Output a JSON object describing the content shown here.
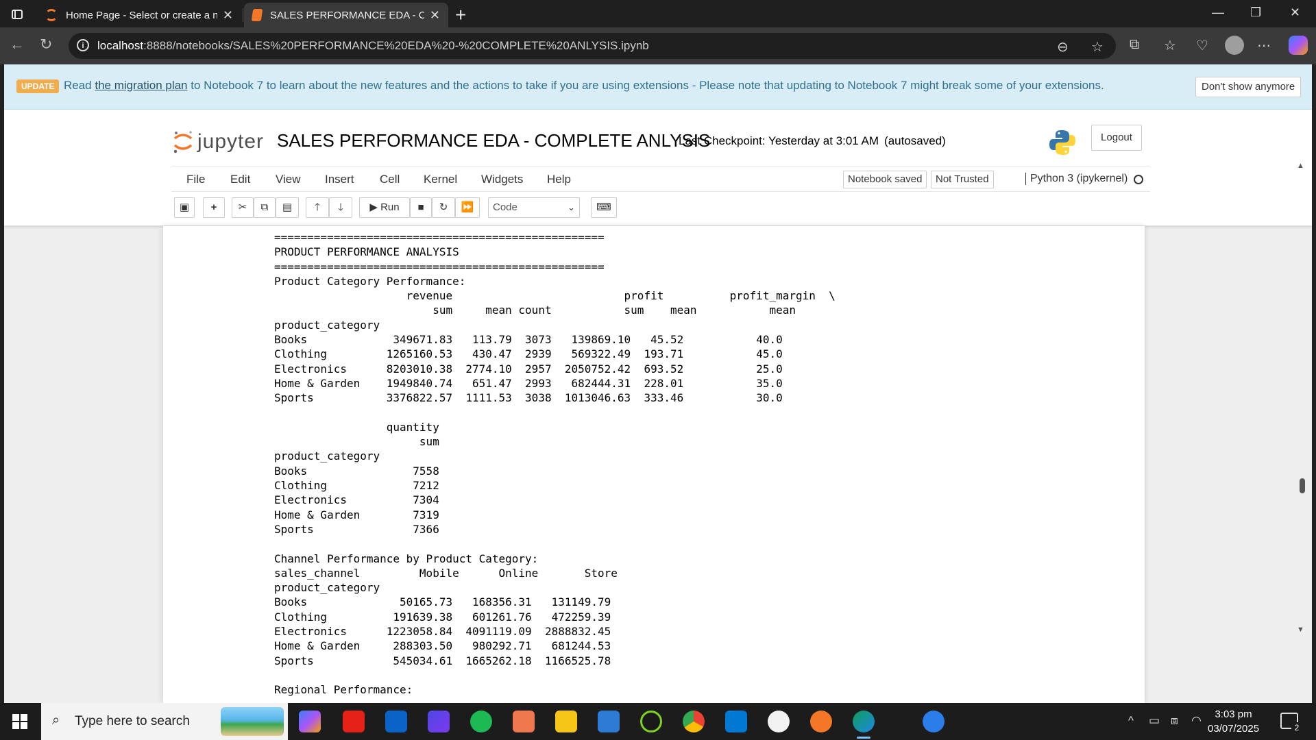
{
  "browser": {
    "tabs": [
      {
        "title": "Home Page - Select or create a notebook",
        "active": false
      },
      {
        "title": "SALES PERFORMANCE EDA - COMPLETE ANLYSIS",
        "active": true
      }
    ],
    "new_tab": "+",
    "url_host": "localhost",
    "url_rest": ":8888/notebooks/SALES%20PERFORMANCE%20EDA%20-%20COMPLETE%20ANLYSIS.ipynb"
  },
  "banner": {
    "badge": "UPDATE",
    "text_before": "Read ",
    "link": "the migration plan",
    "text_after": " to Notebook 7 to learn about the new features and the actions to take if you are using extensions - Please note that updating to Notebook 7 might break some of your extensions.",
    "dismiss": "Don't show anymore"
  },
  "header": {
    "logo_text": "jupyter",
    "notebook_title": "SALES PERFORMANCE EDA - COMPLETE ANLYSIS",
    "checkpoint": "Last Checkpoint: Yesterday at 3:01 AM",
    "autosaved": "(autosaved)",
    "logout": "Logout"
  },
  "menu": {
    "items": [
      "File",
      "Edit",
      "View",
      "Insert",
      "Cell",
      "Kernel",
      "Widgets",
      "Help"
    ],
    "notebook_saved": "Notebook saved",
    "not_trusted": "Not Trusted",
    "kernel": "Python 3 (ipykernel)"
  },
  "toolbar": {
    "run": "Run",
    "cell_type": "Code"
  },
  "output": {
    "lines": [
      "==================================================",
      "PRODUCT PERFORMANCE ANALYSIS",
      "==================================================",
      "Product Category Performance:",
      "                    revenue                          profit          profit_margin  \\",
      "                        sum     mean count           sum    mean           mean",
      "product_category",
      "Books             349671.83   113.79  3073   139869.10   45.52           40.0",
      "Clothing         1265160.53   430.47  2939   569322.49  193.71           45.0",
      "Electronics      8203010.38  2774.10  2957  2050752.42  693.52           25.0",
      "Home & Garden    1949840.74   651.47  2993   682444.31  228.01           35.0",
      "Sports           3376822.57  1111.53  3038  1013046.63  333.46           30.0",
      "",
      "                 quantity",
      "                      sum",
      "product_category",
      "Books                7558",
      "Clothing             7212",
      "Electronics          7304",
      "Home & Garden        7319",
      "Sports               7366",
      "",
      "Channel Performance by Product Category:",
      "sales_channel         Mobile      Online       Store",
      "product_category",
      "Books              50165.73   168356.31   131149.79",
      "Clothing          191639.38   601261.76   472259.39",
      "Electronics      1223058.84  4091119.09  2888832.45",
      "Home & Garden     288303.50   980292.71   681244.53",
      "Sports            545034.61  1665262.18  1166525.78",
      "",
      "Regional Performance:"
    ]
  },
  "taskbar": {
    "search_placeholder": "Type here to search",
    "time": "3:03 pm",
    "date": "03/07/2025",
    "notifications": "2"
  }
}
